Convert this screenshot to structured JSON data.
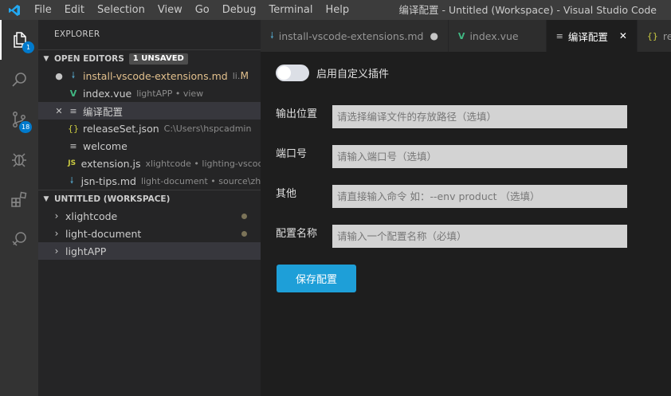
{
  "titlebar": {
    "menu": [
      "File",
      "Edit",
      "Selection",
      "View",
      "Go",
      "Debug",
      "Terminal",
      "Help"
    ],
    "window_title": "编译配置 - Untitled (Workspace) - Visual Studio Code"
  },
  "activity_bar": {
    "explorer_badge": "1",
    "scm_badge": "18"
  },
  "sidebar": {
    "title": "EXPLORER",
    "open_editors": {
      "header": "OPEN EDITORS",
      "badge": "1 UNSAVED",
      "items": [
        {
          "status": "●",
          "icon": "markdown-icon",
          "name": "install-vscode-extensions.md",
          "desc": "li...",
          "flag": "M"
        },
        {
          "status": "",
          "icon": "vue-icon",
          "name": "index.vue",
          "desc": "lightAPP • view",
          "flag": ""
        },
        {
          "status": "✕",
          "icon": "lines-icon",
          "name": "编译配置",
          "desc": "",
          "flag": ""
        },
        {
          "status": "",
          "icon": "json-icon",
          "name": "releaseSet.json",
          "desc": "C:\\Users\\hspcadmin",
          "flag": ""
        },
        {
          "status": "",
          "icon": "lines-icon",
          "name": "welcome",
          "desc": "",
          "flag": ""
        },
        {
          "status": "",
          "icon": "js-icon",
          "name": "extension.js",
          "desc": "xlightcode • lighting-vscode",
          "flag": ""
        },
        {
          "status": "",
          "icon": "markdown-icon",
          "name": "jsn-tips.md",
          "desc": "light-document • source\\zh...",
          "flag": ""
        }
      ]
    },
    "workspace": {
      "header": "UNTITLED (WORKSPACE)",
      "folders": [
        {
          "name": "xlightcode",
          "dot": true
        },
        {
          "name": "light-document",
          "dot": true
        },
        {
          "name": "lightAPP",
          "dot": false
        }
      ]
    }
  },
  "tabs": [
    {
      "icon": "markdown-icon",
      "label": "install-vscode-extensions.md",
      "suffix": "●",
      "active": false
    },
    {
      "icon": "vue-icon",
      "label": "index.vue",
      "suffix": "",
      "active": false
    },
    {
      "icon": "lines-icon",
      "label": "编译配置",
      "suffix": "✕",
      "active": true
    },
    {
      "icon": "json-icon",
      "label": "rele",
      "suffix": "",
      "active": false
    }
  ],
  "form": {
    "toggle_label": "启用自定义插件",
    "fields": [
      {
        "label": "输出位置",
        "placeholder": "请选择编译文件的存放路径（选填）"
      },
      {
        "label": "端口号",
        "placeholder": "请输入端口号（选填）"
      },
      {
        "label": "其他",
        "placeholder": "请直接输入命令 如：--env product （选填）"
      },
      {
        "label": "配置名称",
        "placeholder": "请输入一个配置名称（必填）"
      }
    ],
    "save_label": "保存配置"
  },
  "colors": {
    "accent": "#007acc",
    "button": "#1e9fd8",
    "modified": "#e2c08d",
    "vue": "#41b883",
    "markdown": "#519aba",
    "json": "#cbcb41"
  }
}
